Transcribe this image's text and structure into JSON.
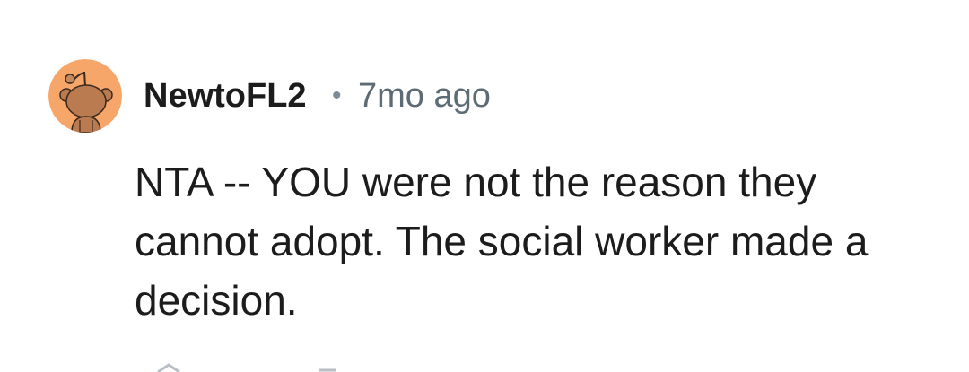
{
  "comment": {
    "avatar_icon": "snoo-avatar-icon",
    "avatar_bg_color": "#f7a66a",
    "username": "NewtoFL2",
    "separator": "•",
    "timestamp": "7mo ago",
    "body": "NTA -- YOU were not the reason they cannot adopt. The social worker made a decision."
  },
  "actions": {
    "upvote_icon": "upvote-icon",
    "reply_icon": "reply-icon"
  }
}
